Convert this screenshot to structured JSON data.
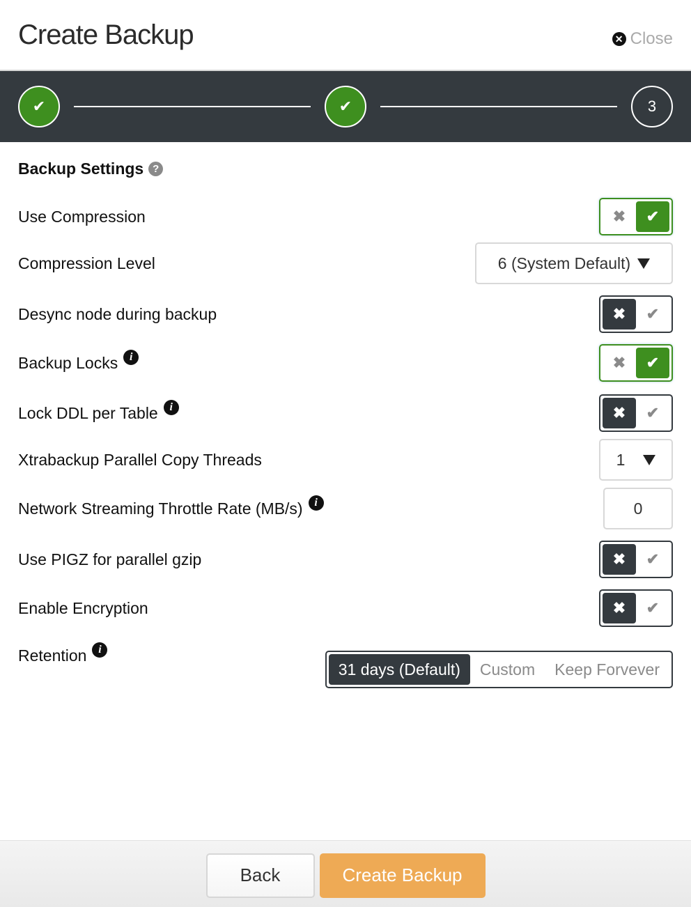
{
  "header": {
    "title": "Create Backup",
    "close_label": "Close",
    "close_icon": "close-circle-icon"
  },
  "stepper": {
    "steps": [
      {
        "state": "complete",
        "icon": "check-icon",
        "label": "✔"
      },
      {
        "state": "complete",
        "icon": "check-icon",
        "label": "✔"
      },
      {
        "state": "current",
        "label": "3"
      }
    ]
  },
  "section": {
    "title": "Backup Settings",
    "help_icon": "?"
  },
  "settings": [
    {
      "label": "Use Compression",
      "type": "toggle",
      "value": true,
      "has_info": false
    },
    {
      "label": "Compression Level",
      "type": "select",
      "value": "6 (System Default)",
      "has_info": false
    },
    {
      "label": "Desync node during backup",
      "type": "toggle",
      "value": false,
      "has_info": false
    },
    {
      "label": "Backup Locks",
      "type": "toggle",
      "value": true,
      "has_info": true
    },
    {
      "label": "Lock DDL per Table",
      "type": "toggle",
      "value": false,
      "has_info": true
    },
    {
      "label": "Xtrabackup Parallel Copy Threads",
      "type": "select",
      "value": "1",
      "has_info": false
    },
    {
      "label": "Network Streaming Throttle Rate (MB/s)",
      "type": "input",
      "value": "0",
      "has_info": true
    },
    {
      "label": "Use PIGZ for parallel gzip",
      "type": "toggle",
      "value": false,
      "has_info": false
    },
    {
      "label": "Enable Encryption",
      "type": "toggle",
      "value": false,
      "has_info": false
    },
    {
      "label": "Retention",
      "type": "segmented",
      "has_info": true,
      "options": [
        "31 days (Default)",
        "Custom",
        "Keep Forvever"
      ],
      "selected": "31 days (Default)"
    }
  ],
  "glyphs": {
    "x": "✖",
    "check": "✔",
    "info": "i"
  },
  "footer": {
    "back_label": "Back",
    "create_label": "Create Backup"
  },
  "colors": {
    "success_green": "#3e8f1f",
    "dark": "#343a3f",
    "primary_orange": "#eeaa55"
  }
}
